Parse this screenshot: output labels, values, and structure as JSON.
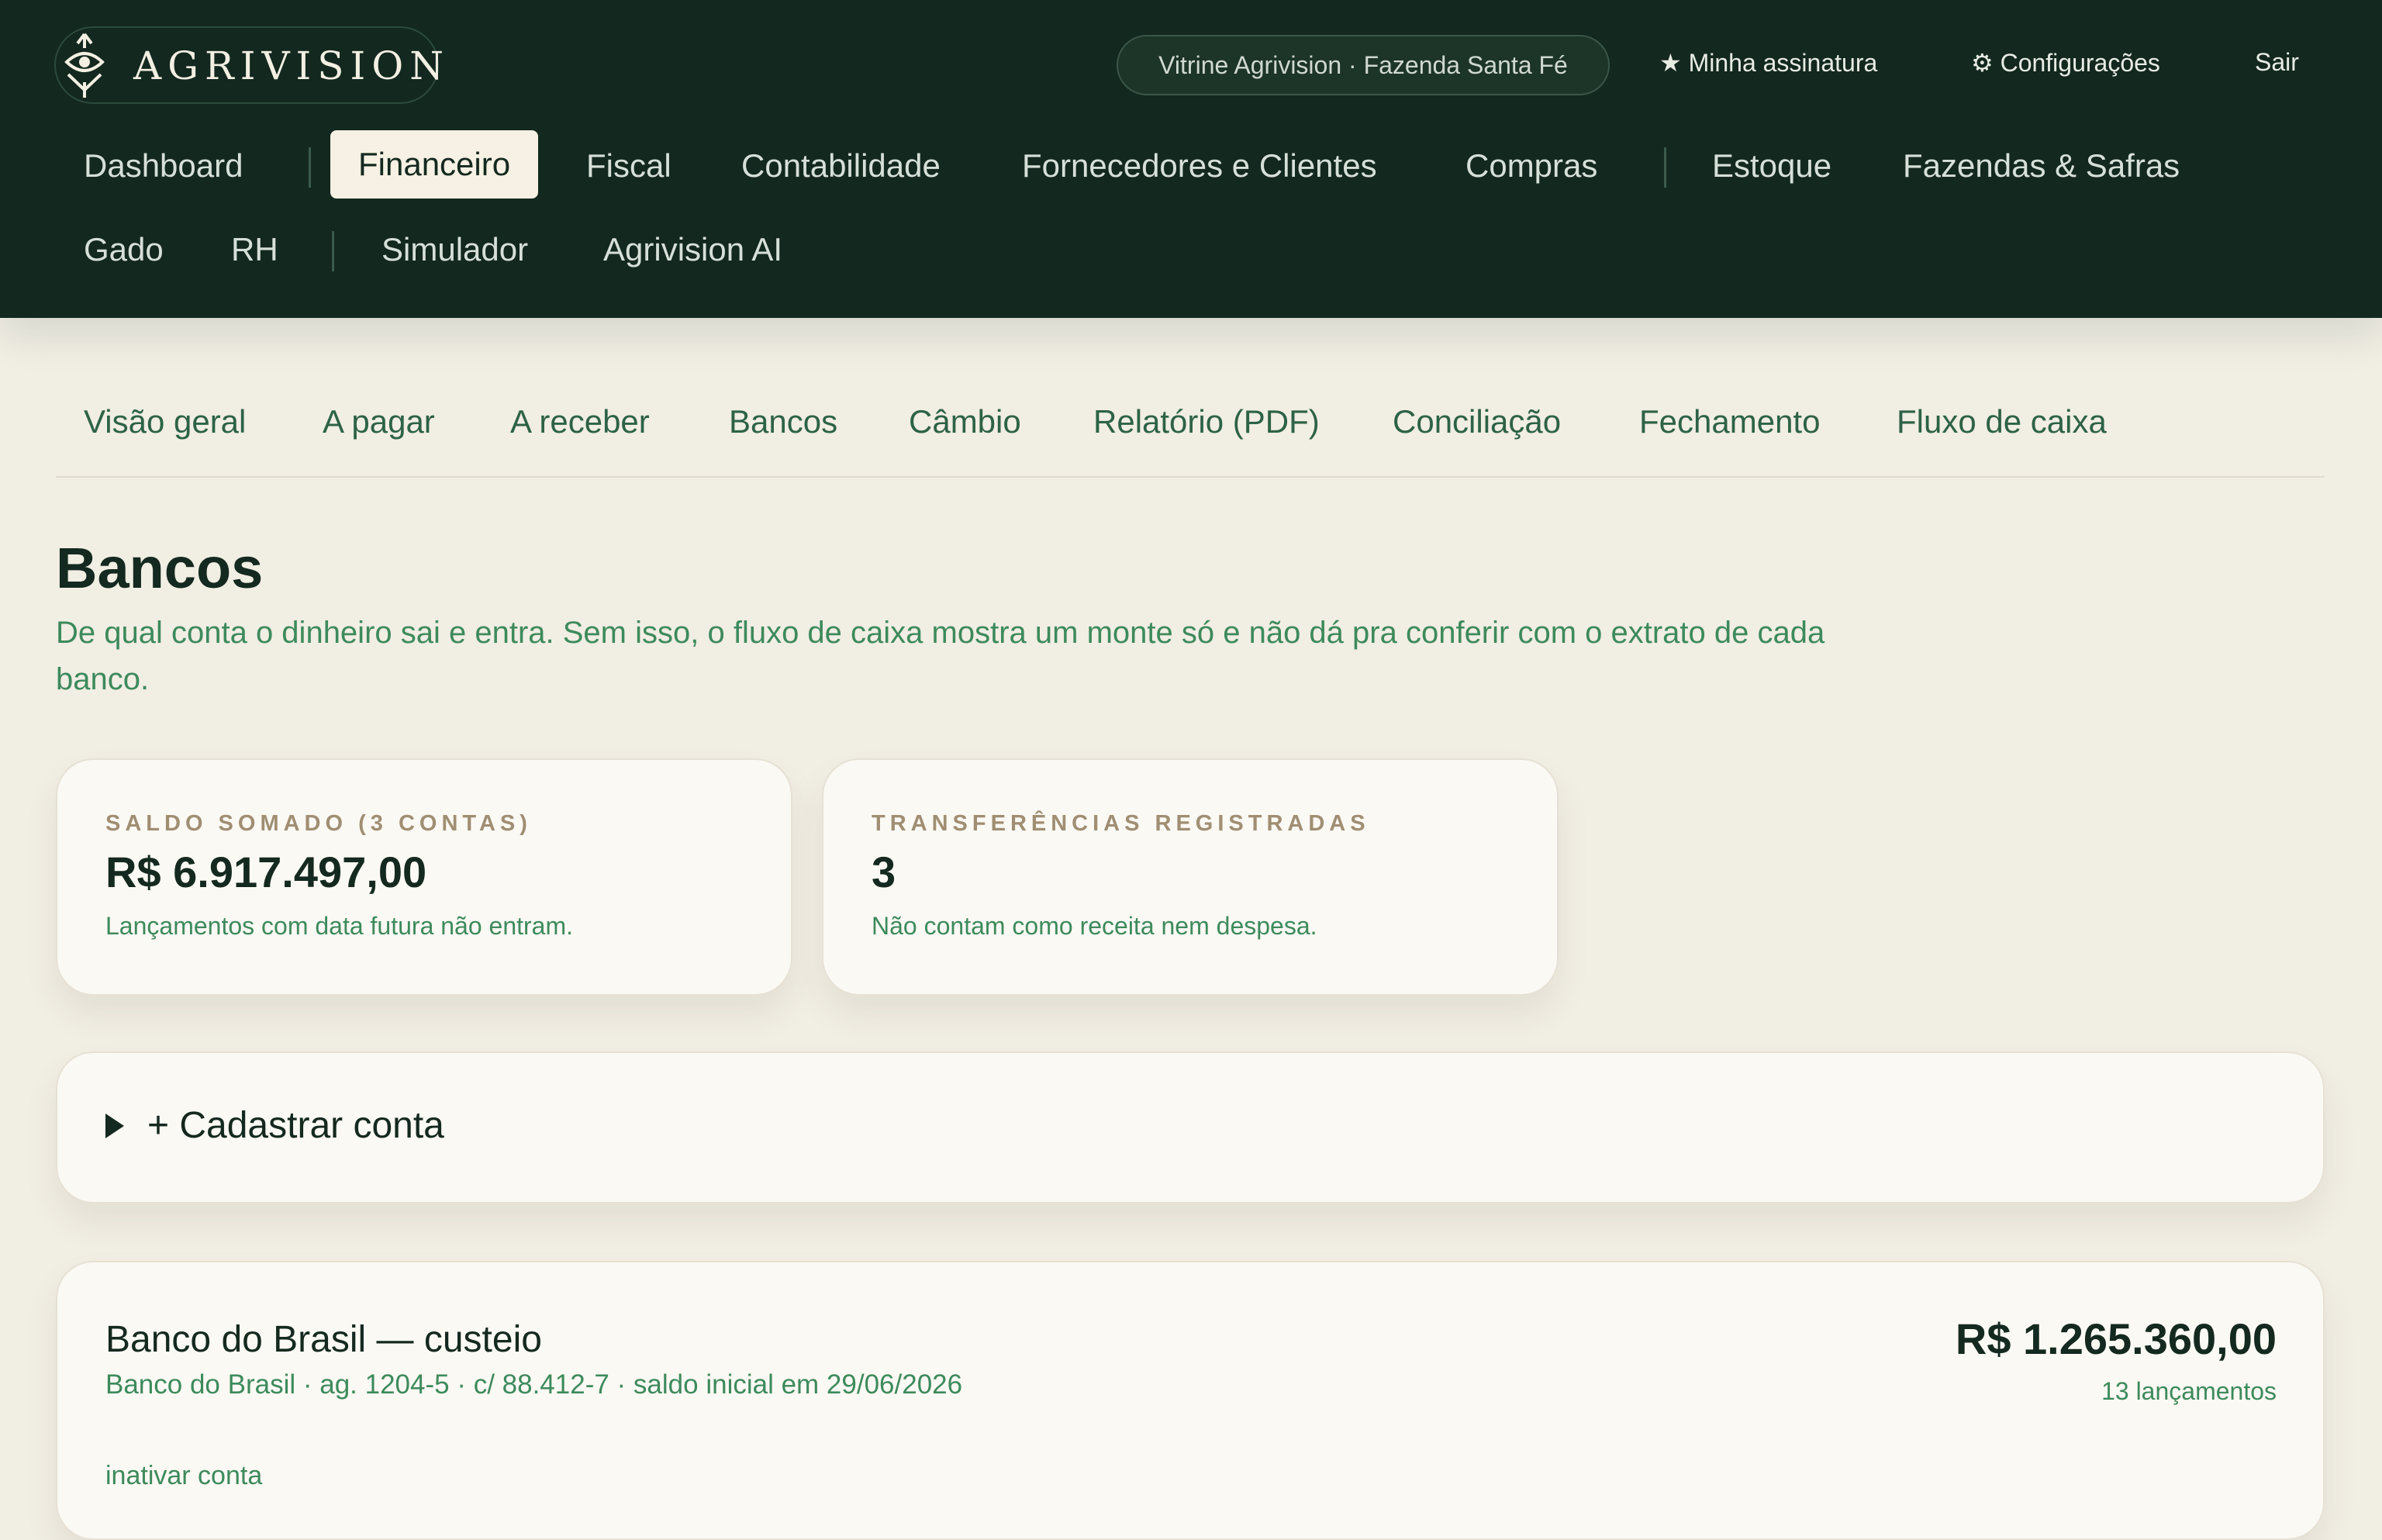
{
  "brand": {
    "name": "AGRIVISION"
  },
  "header": {
    "context": "Vitrine Agrivision · Fazenda Santa Fé",
    "subscription": "★ Minha assinatura",
    "settings": "⚙ Configurações",
    "logout": "Sair"
  },
  "nav": {
    "items": [
      {
        "label": "Dashboard"
      },
      {
        "label": "Financeiro",
        "active": true
      },
      {
        "label": "Fiscal"
      },
      {
        "label": "Contabilidade"
      },
      {
        "label": "Fornecedores e Clientes"
      },
      {
        "label": "Compras"
      },
      {
        "label": "Estoque"
      },
      {
        "label": "Fazendas & Safras"
      },
      {
        "label": "Gado"
      },
      {
        "label": "RH"
      },
      {
        "label": "Simulador"
      },
      {
        "label": "Agrivision AI"
      }
    ]
  },
  "subnav": {
    "items": [
      {
        "label": "Visão geral"
      },
      {
        "label": "A pagar"
      },
      {
        "label": "A receber"
      },
      {
        "label": "Bancos",
        "active": true
      },
      {
        "label": "Câmbio"
      },
      {
        "label": "Relatório (PDF)"
      },
      {
        "label": "Conciliação"
      },
      {
        "label": "Fechamento"
      },
      {
        "label": "Fluxo de caixa"
      }
    ]
  },
  "page": {
    "title": "Bancos",
    "description": "De qual conta o dinheiro sai e entra. Sem isso, o fluxo de caixa mostra um monte só e não dá pra conferir com o extrato de cada banco."
  },
  "kpis": [
    {
      "label": "SALDO SOMADO (3 CONTAS)",
      "value": "R$ 6.917.497,00",
      "note": "Lançamentos com data futura não entram."
    },
    {
      "label": "TRANSFERÊNCIAS REGISTRADAS",
      "value": "3",
      "note": "Não contam como receita nem despesa."
    }
  ],
  "add_account": {
    "label": "+ Cadastrar conta"
  },
  "accounts": [
    {
      "name": "Banco do Brasil — custeio",
      "meta": "Banco do Brasil · ag. 1204-5 · c/ 88.412-7 · saldo inicial em 29/06/2026",
      "balance": "R$ 1.265.360,00",
      "entries": "13 lançamentos",
      "deactivate": "inativar conta"
    }
  ],
  "colors": {
    "header_bg": "#13281f",
    "page_bg": "#f1eee4",
    "accent_green": "#3d8a5c",
    "label_tan": "#a08e73"
  }
}
